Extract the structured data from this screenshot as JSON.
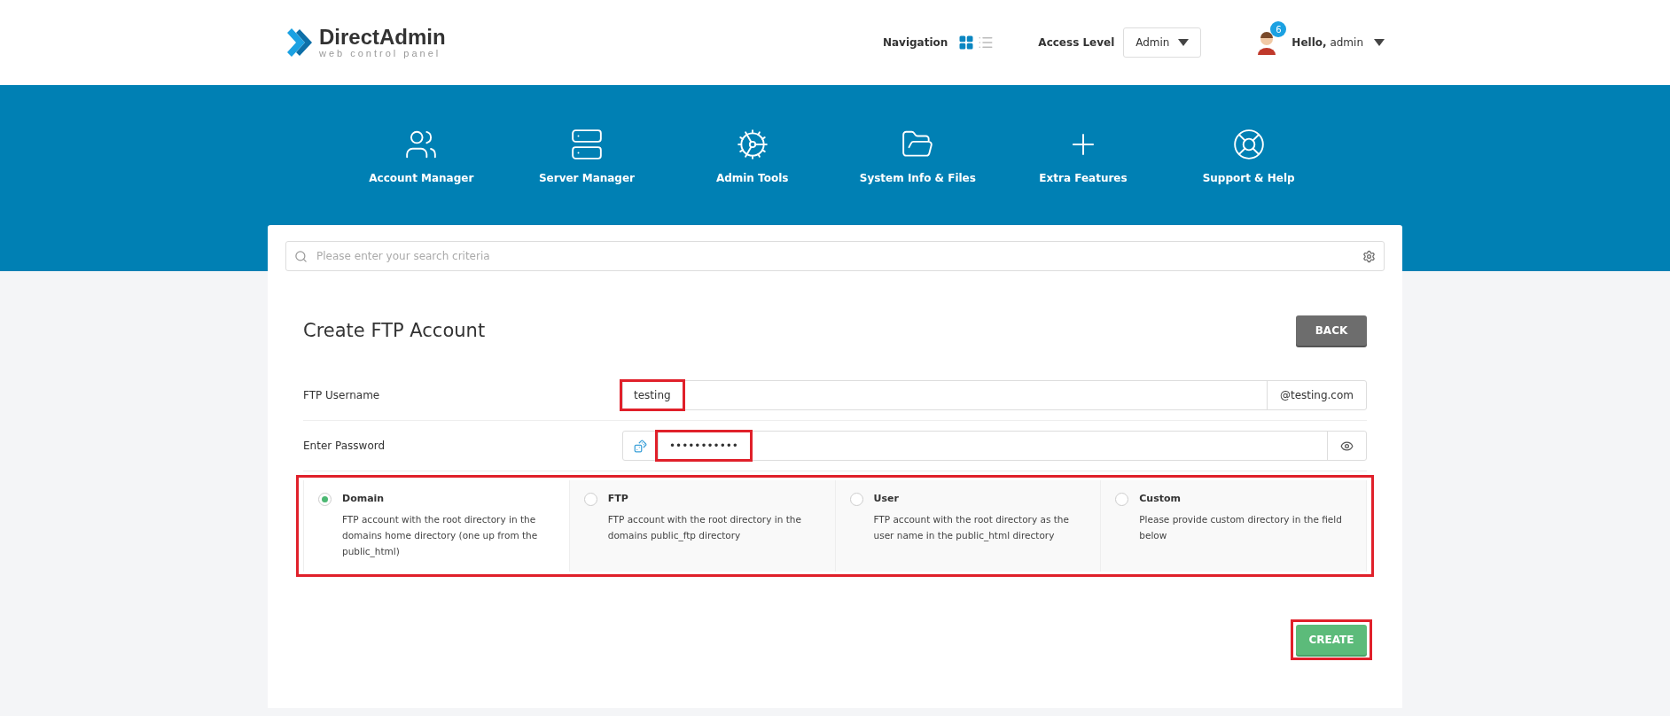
{
  "header": {
    "logo": {
      "name": "DirectAdmin",
      "tagline": "web control panel"
    },
    "navigation_label": "Navigation",
    "view_modes": [
      {
        "kind": "grid",
        "selected": true
      },
      {
        "kind": "list",
        "selected": false
      }
    ],
    "access_level": {
      "label": "Access Level",
      "value": "Admin"
    },
    "user": {
      "notifications": "6",
      "greeting": "Hello,",
      "name": "admin"
    }
  },
  "menu": [
    {
      "kind": "users",
      "label": "Account Manager"
    },
    {
      "kind": "server",
      "label": "Server Manager"
    },
    {
      "kind": "tools",
      "label": "Admin Tools"
    },
    {
      "kind": "folder",
      "label": "System Info & Files"
    },
    {
      "kind": "plus",
      "label": "Extra Features"
    },
    {
      "kind": "support",
      "label": "Support & Help"
    }
  ],
  "search": {
    "placeholder": "Please enter your search criteria"
  },
  "page": {
    "title": "Create FTP Account",
    "back_button": "BACK",
    "username": {
      "label": "FTP Username",
      "value": "testing",
      "suffix": "@testing.com",
      "highlighted": true
    },
    "password": {
      "label": "Enter Password",
      "value": "•••••••••••",
      "highlighted": true
    },
    "options_highlighted": true,
    "options": [
      {
        "title": "Domain",
        "description": "FTP account with the root directory in the domains home directory (one up from the public_html)",
        "selected": true
      },
      {
        "title": "FTP",
        "description": "FTP account with the root directory in the domains public_ftp directory",
        "selected": false
      },
      {
        "title": "User",
        "description": "FTP account with the root directory as the user name in the public_html directory",
        "selected": false
      },
      {
        "title": "Custom",
        "description": "Please provide custom directory in the field below",
        "selected": false
      }
    ],
    "create_button": {
      "label": "CREATE",
      "highlighted": true
    }
  }
}
